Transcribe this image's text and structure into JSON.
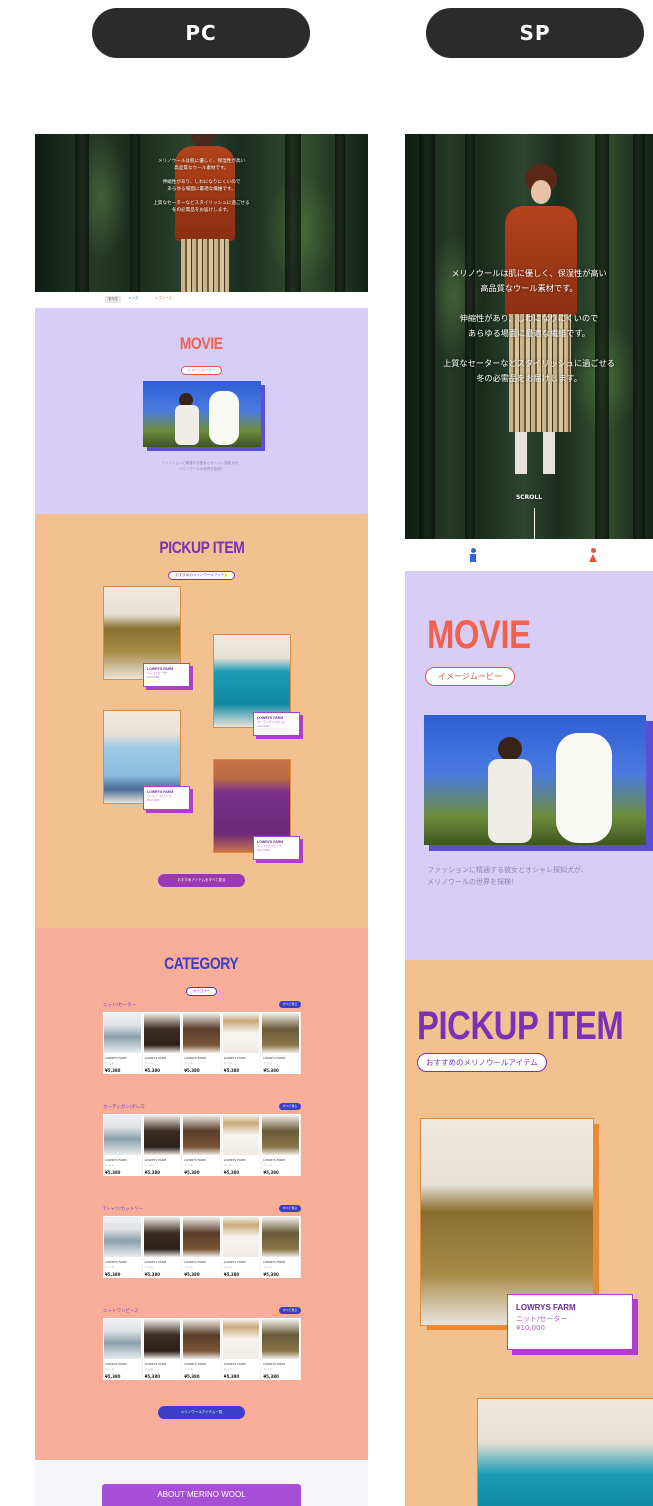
{
  "tabs": {
    "pc": "PC",
    "sp": "SP"
  },
  "pc": {
    "hero": {
      "lines": [
        "メリノウールは肌に優しく、保湿性が高い",
        "高品質なウール素材です。",
        "",
        "伸縮性があり、しわになりにくいので",
        "あらゆる場面に最適な繊維です。",
        "",
        "上質なセーターなどスタイリッシュに過ごせる",
        "冬の必需品をお届けします。"
      ],
      "nav": [
        "すべて",
        "メンズ",
        "レディース"
      ]
    },
    "movie": {
      "title": "MOVIE",
      "subtitle": "イメージムービー",
      "caption": [
        "ファッションに精通する彼女とオシャレ探知犬が、",
        "メリノウールの世界を探検！"
      ]
    },
    "pickup": {
      "title": "PICKUP ITEM",
      "subtitle": "おすすめのメリノウールアイテム",
      "items": [
        {
          "brand": "LOWRYS FARM",
          "name": "ニット/セーター",
          "price": "¥10,000"
        },
        {
          "brand": "LOWRYS FARM",
          "name": "カーディガン/ボレロ",
          "price": "¥10,000"
        },
        {
          "brand": "LOWRYS FARM",
          "name": "ワンピース/ドレス",
          "price": "¥10,000"
        },
        {
          "brand": "LOWRYS FARM",
          "name": "ニット/ワンピース",
          "price": "¥10,000"
        }
      ],
      "button": "おすすめアイテムをすべて見る"
    },
    "category": {
      "title": "CATEGORY",
      "subtitle": "カテゴリー",
      "more": "すべて見る",
      "blocks": [
        {
          "name": "ニット/セーター"
        },
        {
          "name": "カーディガン/ボレロ"
        },
        {
          "name": "Tシャツ/カットソー"
        },
        {
          "name": "ニットワンピース"
        }
      ],
      "cell": {
        "brand": "LOWRYS FARM",
        "type": "ニット",
        "price": "¥5,380"
      },
      "button": "メリノウールアイテム一覧"
    },
    "about": {
      "button": "ABOUT MERINO WOOL"
    }
  },
  "sp": {
    "hero": {
      "lines": [
        "メリノウールは肌に優しく、保湿性が高い",
        "高品質なウール素材です。",
        "",
        "伸縮性があり、しわになりにくいので",
        "あらゆる場面に最適な繊維です。",
        "",
        "上質なセーターなどスタイリッシュに過ごせる",
        "冬の必需品をお届けします。"
      ],
      "scroll": "SCROLL"
    },
    "movie": {
      "title": "MOVIE",
      "subtitle": "イメージムービー",
      "caption": [
        "ファッションに精通する彼女とオシャレ探知犬が、",
        "メリノウールの世界を探検！"
      ]
    },
    "pickup": {
      "title": "PICKUP ITEM",
      "subtitle": "おすすめのメリノウールアイテム",
      "item": {
        "brand": "LOWRYS FARM",
        "name": "ニット/セーター",
        "price": "¥10,000"
      }
    }
  },
  "colors": {
    "movie_bg": "#d8cdf7",
    "pickup_bg": "#f3c08f",
    "category_bg": "#f8ad98",
    "accent": "#9b38b8"
  }
}
